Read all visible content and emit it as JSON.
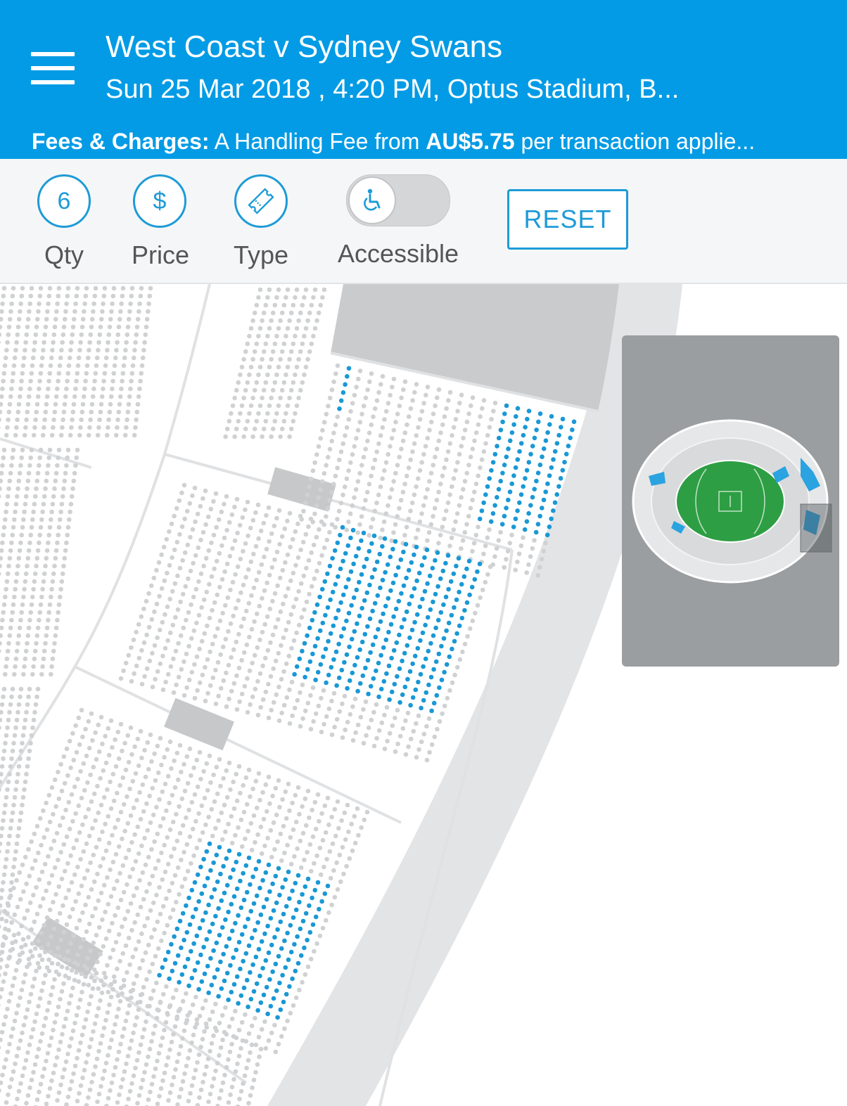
{
  "header": {
    "title": "West Coast v Sydney Swans",
    "subtitle": "Sun 25 Mar 2018 , 4:20 PM, Optus Stadium, B...",
    "fees_label": "Fees & Charges:",
    "fees_text_1": " A Handling Fee from ",
    "fees_amount": "AU$5.75",
    "fees_text_2": " per transaction applie..."
  },
  "filters": {
    "qty_value": "6",
    "qty_label": "Qty",
    "price_symbol": "$",
    "price_label": "Price",
    "type_label": "Type",
    "accessible_label": "Accessible",
    "accessible_on": false,
    "reset_label": "RESET"
  },
  "icons": {
    "menu": "hamburger-icon",
    "type": "ticket-icon",
    "accessible": "wheelchair-icon"
  },
  "colors": {
    "brand": "#039be5",
    "accent": "#1e9bd7",
    "seat_available": "#1a98d5",
    "seat_unavailable": "#cfd1d3",
    "field": "#2e9e44"
  }
}
